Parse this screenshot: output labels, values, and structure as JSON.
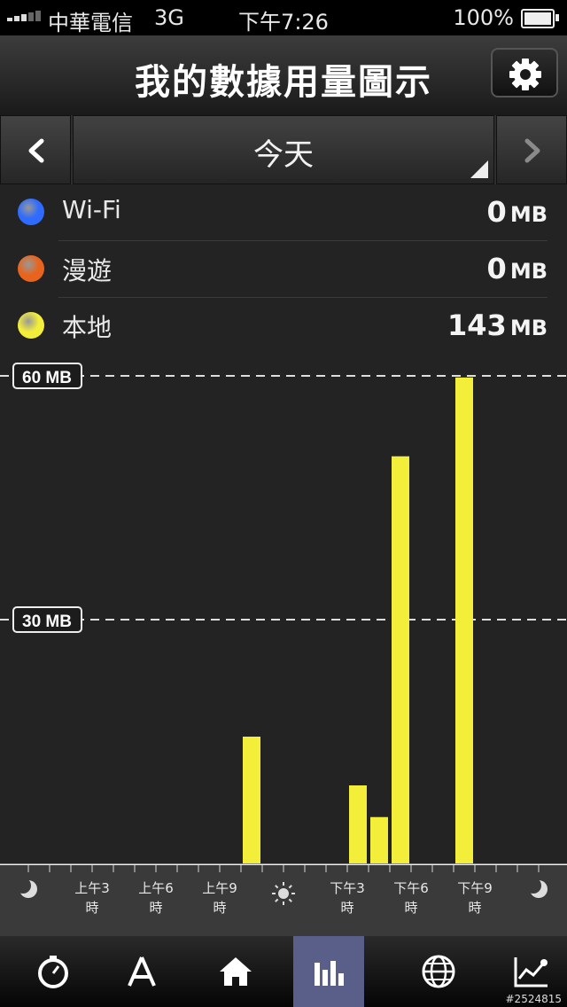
{
  "status_bar": {
    "carrier": "中華電信",
    "network": "3G",
    "time": "下午7:26",
    "battery": "100%"
  },
  "header": {
    "title": "我的數據用量圖示",
    "settings_icon": "gear-icon"
  },
  "date_selector": {
    "label": "今天",
    "prev_icon": "chevron-left-icon",
    "next_icon": "chevron-right-icon"
  },
  "legend": [
    {
      "name": "Wi-Fi",
      "value": "0",
      "unit": "MB",
      "color": "#2f6bff"
    },
    {
      "name": "漫遊",
      "value": "0",
      "unit": "MB",
      "color": "#e8641e"
    },
    {
      "name": "本地",
      "value": "143",
      "unit": "MB",
      "color": "#f2ee3a"
    }
  ],
  "chart_data": {
    "type": "bar",
    "title": "",
    "xlabel": "",
    "ylabel": "",
    "ylim": [
      0,
      60
    ],
    "y_ticks": [
      "30 MB",
      "60 MB"
    ],
    "y_tick_values": [
      30,
      60
    ],
    "hour_slots": 24,
    "x_tick_labels": [
      "",
      "上午3 時",
      "上午6 時",
      "上午9 時",
      "",
      "下午3 時",
      "下午6 時",
      "下午9 時",
      ""
    ],
    "x_tick_icons": [
      "moon-icon",
      "",
      "",
      "",
      "sun-icon",
      "",
      "",
      "",
      "moon-icon"
    ],
    "series": [
      {
        "name": "本地",
        "color": "#f2ee3a",
        "values": [
          0,
          0,
          0,
          0,
          0,
          0,
          0,
          0,
          0,
          0,
          15.6,
          0,
          0,
          0,
          0,
          9.6,
          5.7,
          50.1,
          0,
          0,
          59.8,
          0,
          0,
          0
        ]
      }
    ]
  },
  "tab_bar": {
    "tabs": [
      {
        "name": "stopwatch-icon",
        "active": false
      },
      {
        "name": "app-store-icon",
        "active": false
      },
      {
        "name": "home-icon",
        "active": false
      },
      {
        "name": "bar-chart-icon",
        "active": true
      },
      {
        "name": "globe-icon",
        "active": false
      },
      {
        "name": "line-chart-icon",
        "active": false
      }
    ]
  },
  "watermark": "#2524815"
}
